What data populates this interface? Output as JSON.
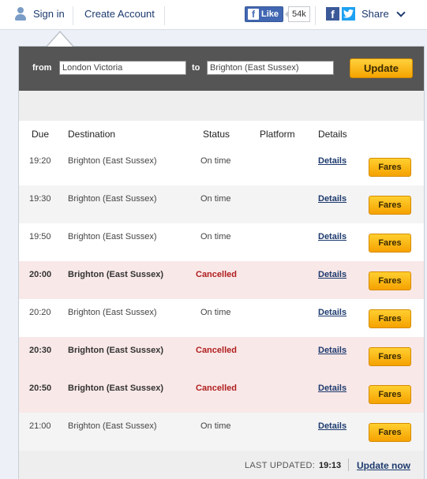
{
  "header": {
    "signin_label": "Sign in",
    "create_account_label": "Create Account",
    "fb_like_label": "Like",
    "fb_like_count": "54k",
    "share_label": "Share"
  },
  "search": {
    "from_label": "from",
    "from_value": "London Victoria",
    "to_label": "to",
    "to_value": "Brighton (East Sussex)",
    "update_label": "Update"
  },
  "table": {
    "headers": [
      "Due",
      "Destination",
      "Status",
      "Platform",
      "Details"
    ],
    "rows": [
      {
        "due": "19:20",
        "destination": "Brighton (East Sussex)",
        "status": "On time",
        "platform": "",
        "details": "Details",
        "fares": "Fares",
        "state": "normal"
      },
      {
        "due": "19:30",
        "destination": "Brighton (East Sussex)",
        "status": "On time",
        "platform": "",
        "details": "Details",
        "fares": "Fares",
        "state": "alt"
      },
      {
        "due": "19:50",
        "destination": "Brighton (East Sussex)",
        "status": "On time",
        "platform": "",
        "details": "Details",
        "fares": "Fares",
        "state": "normal"
      },
      {
        "due": "20:00",
        "destination": "Brighton (East Sussex)",
        "status": "Cancelled",
        "platform": "",
        "details": "Details",
        "fares": "Fares",
        "state": "cancel"
      },
      {
        "due": "20:20",
        "destination": "Brighton (East Sussex)",
        "status": "On time",
        "platform": "",
        "details": "Details",
        "fares": "Fares",
        "state": "normal"
      },
      {
        "due": "20:30",
        "destination": "Brighton (East Sussex)",
        "status": "Cancelled",
        "platform": "",
        "details": "Details",
        "fares": "Fares",
        "state": "cancel"
      },
      {
        "due": "20:50",
        "destination": "Brighton (East Sussex)",
        "status": "Cancelled",
        "platform": "",
        "details": "Details",
        "fares": "Fares",
        "state": "cancel"
      },
      {
        "due": "21:00",
        "destination": "Brighton (East Sussex)",
        "status": "On time",
        "platform": "",
        "details": "Details",
        "fares": "Fares",
        "state": "alt"
      }
    ]
  },
  "footer": {
    "last_updated_label": "LAST UPDATED:",
    "last_updated_time": "19:13",
    "update_now_label": "Update now"
  },
  "colors": {
    "accent_orange": "#f5a400",
    "cancel_text": "#b01e1e",
    "cancel_row_bg": "#f9e8e8",
    "link_blue": "#1d3a6e",
    "searchbar_bg": "#555555"
  },
  "icons": [
    "user-icon",
    "facebook-icon",
    "twitter-icon",
    "chevron-down-icon"
  ]
}
